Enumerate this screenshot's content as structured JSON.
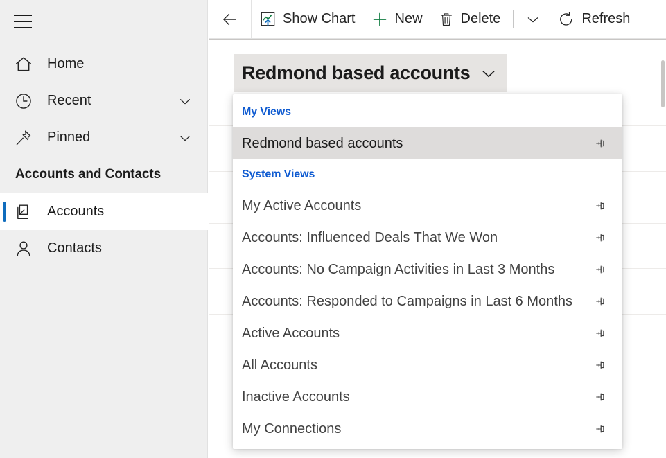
{
  "sidebar": {
    "menu_icon": "hamburger-icon",
    "items": [
      {
        "label": "Home",
        "icon": "home-icon",
        "expandable": false
      },
      {
        "label": "Recent",
        "icon": "clock-icon",
        "expandable": true
      },
      {
        "label": "Pinned",
        "icon": "pin-icon",
        "expandable": true
      }
    ],
    "section_title": "Accounts and Contacts",
    "entities": [
      {
        "label": "Accounts",
        "icon": "accounts-icon",
        "selected": true
      },
      {
        "label": "Contacts",
        "icon": "person-icon",
        "selected": false
      }
    ],
    "selection_color": "#0f6cbd"
  },
  "commandbar": {
    "back_label": "Back",
    "buttons": [
      {
        "label": "Show Chart",
        "icon": "chart-icon"
      },
      {
        "label": "New",
        "icon": "plus-icon"
      },
      {
        "label": "Delete",
        "icon": "trash-icon"
      }
    ],
    "overflow_icon": "chevron-down-icon",
    "refresh": {
      "label": "Refresh",
      "icon": "refresh-icon"
    }
  },
  "view_selector": {
    "current_view": "Redmond based accounts",
    "caret_icon": "chevron-down-icon",
    "expanded": true
  },
  "view_flyout": {
    "groups": [
      {
        "label": "My Views",
        "label_color": "#0f5bd1",
        "items": [
          {
            "label": "Redmond based accounts",
            "pin_icon": "pin-icon",
            "selected": true
          }
        ]
      },
      {
        "label": "System Views",
        "label_color": "#0f5bd1",
        "items": [
          {
            "label": "My Active Accounts",
            "pin_icon": "pin-icon",
            "selected": false
          },
          {
            "label": "Accounts: Influenced Deals That We Won",
            "pin_icon": "pin-icon",
            "selected": false
          },
          {
            "label": "Accounts: No Campaign Activities in Last 3 Months",
            "pin_icon": "pin-icon",
            "selected": false
          },
          {
            "label": "Accounts: Responded to Campaigns in Last 6 Months",
            "pin_icon": "pin-icon",
            "selected": false
          },
          {
            "label": "Active Accounts",
            "pin_icon": "pin-icon",
            "selected": false
          },
          {
            "label": "All Accounts",
            "pin_icon": "pin-icon",
            "selected": false
          },
          {
            "label": "Inactive Accounts",
            "pin_icon": "pin-icon",
            "selected": false
          },
          {
            "label": "My Connections",
            "pin_icon": "pin-icon",
            "selected": false
          }
        ]
      }
    ]
  }
}
